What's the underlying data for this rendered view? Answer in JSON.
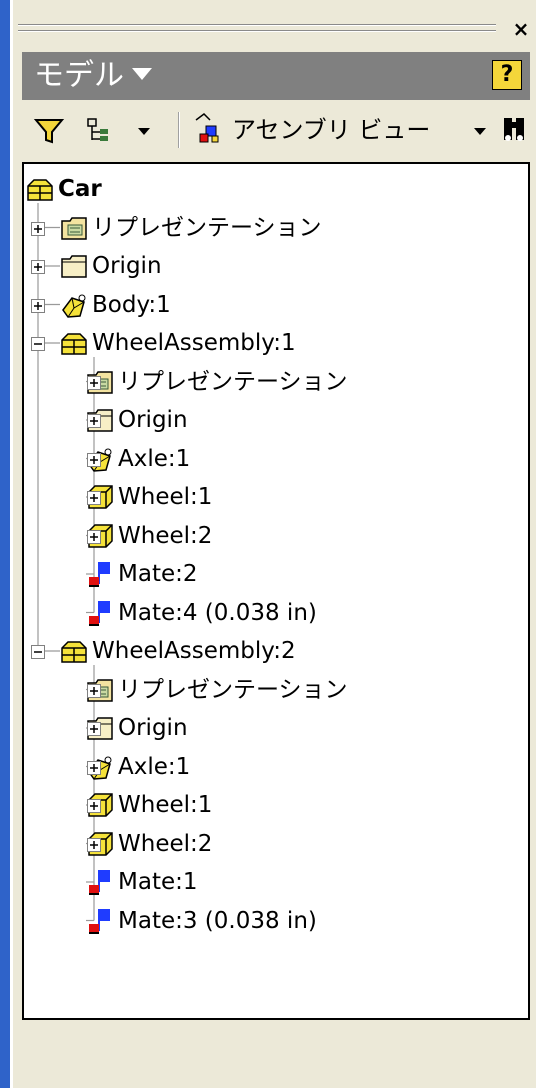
{
  "panel": {
    "title": "モデル",
    "help": "?",
    "close": "×"
  },
  "toolbar": {
    "view_label": "アセンブリ ビュー"
  },
  "tree": [
    {
      "label": "Car",
      "icon": "assembly-icon",
      "level": 0,
      "expander": "none"
    },
    {
      "label": "リプレゼンテーション",
      "icon": "representation-icon",
      "level": 1,
      "expander": "plus"
    },
    {
      "label": "Origin",
      "icon": "folder-icon",
      "level": 1,
      "expander": "plus"
    },
    {
      "label": "Body:1",
      "icon": "part-icon",
      "level": 1,
      "expander": "plus"
    },
    {
      "label": "WheelAssembly:1",
      "icon": "assembly-icon",
      "level": 1,
      "expander": "minus"
    },
    {
      "label": "リプレゼンテーション",
      "icon": "representation-icon",
      "level": 2,
      "expander": "plus"
    },
    {
      "label": "Origin",
      "icon": "folder-icon",
      "level": 2,
      "expander": "plus"
    },
    {
      "label": "Axle:1",
      "icon": "part-icon",
      "level": 2,
      "expander": "plus"
    },
    {
      "label": "Wheel:1",
      "icon": "box-icon",
      "level": 2,
      "expander": "plus"
    },
    {
      "label": "Wheel:2",
      "icon": "box-icon",
      "level": 2,
      "expander": "plus"
    },
    {
      "label": "Mate:2",
      "icon": "mate-icon",
      "level": 2,
      "expander": "none"
    },
    {
      "label": "Mate:4 (0.038 in)",
      "icon": "mate-icon",
      "level": 2,
      "expander": "none"
    },
    {
      "label": "WheelAssembly:2",
      "icon": "assembly-icon",
      "level": 1,
      "expander": "minus"
    },
    {
      "label": "リプレゼンテーション",
      "icon": "representation-icon",
      "level": 2,
      "expander": "plus"
    },
    {
      "label": "Origin",
      "icon": "folder-icon",
      "level": 2,
      "expander": "plus"
    },
    {
      "label": "Axle:1",
      "icon": "part-icon",
      "level": 2,
      "expander": "plus"
    },
    {
      "label": "Wheel:1",
      "icon": "box-icon",
      "level": 2,
      "expander": "plus"
    },
    {
      "label": "Wheel:2",
      "icon": "box-icon",
      "level": 2,
      "expander": "plus"
    },
    {
      "label": "Mate:1",
      "icon": "mate-icon",
      "level": 2,
      "expander": "none"
    },
    {
      "label": "Mate:3 (0.038 in)",
      "icon": "mate-icon",
      "level": 2,
      "expander": "none"
    }
  ],
  "colors": {
    "accent": "#2f63c9",
    "titlebar": "#808080",
    "icon_yellow": "#f5e23a",
    "mate_blue": "#1f3cff",
    "mate_red": "#e01010"
  }
}
